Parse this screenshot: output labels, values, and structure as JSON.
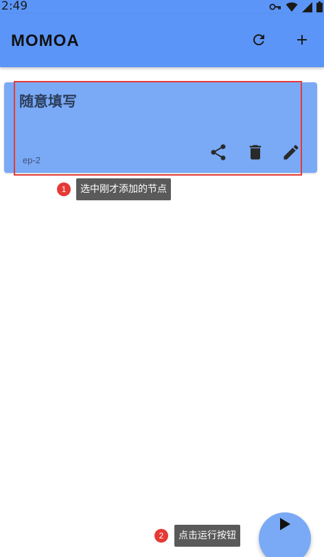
{
  "status_bar": {
    "time": "2:49",
    "icons": [
      "vpn-key-icon",
      "wifi-icon",
      "cell-signal-icon",
      "battery-icon"
    ]
  },
  "app_bar": {
    "title": "MOMOA",
    "actions": [
      {
        "name": "refresh-icon"
      },
      {
        "name": "add-icon"
      }
    ]
  },
  "card": {
    "title": "随意填写",
    "subtitle": "ep-2",
    "actions": [
      {
        "name": "share-icon"
      },
      {
        "name": "delete-icon"
      },
      {
        "name": "edit-icon"
      }
    ]
  },
  "annotations": [
    {
      "step": "1",
      "text": "选中刚才添加的节点"
    },
    {
      "step": "2",
      "text": "点击运行按钮"
    }
  ],
  "fab": {
    "icon": "play-icon"
  },
  "colors": {
    "primary": "#5b95f7",
    "card": "#7aaaf6",
    "highlight": "#e53935",
    "tooltip": "#5a5a5a"
  }
}
